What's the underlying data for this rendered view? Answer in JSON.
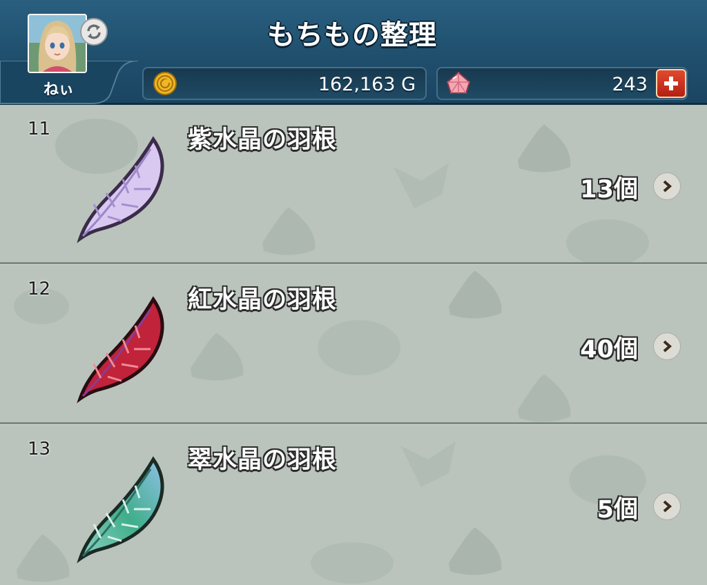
{
  "header": {
    "title": "もちもの整理",
    "player_name": "ねぃ",
    "gold_amount": "162,163 G",
    "gem_amount": "243",
    "icons": {
      "avatar": "player-avatar",
      "sync": "sync-icon",
      "coin": "gold-coin-icon",
      "gem": "gem-icon",
      "plus": "plus-icon"
    }
  },
  "items": [
    {
      "number": "11",
      "name": "紫水晶の羽根",
      "quantity": "13個",
      "color": "#b9a4e0"
    },
    {
      "number": "12",
      "name": "紅水晶の羽根",
      "quantity": "40個",
      "color": "#c0233a"
    },
    {
      "number": "13",
      "name": "翠水晶の羽根",
      "quantity": "5個",
      "color": "#3fae8a"
    }
  ]
}
